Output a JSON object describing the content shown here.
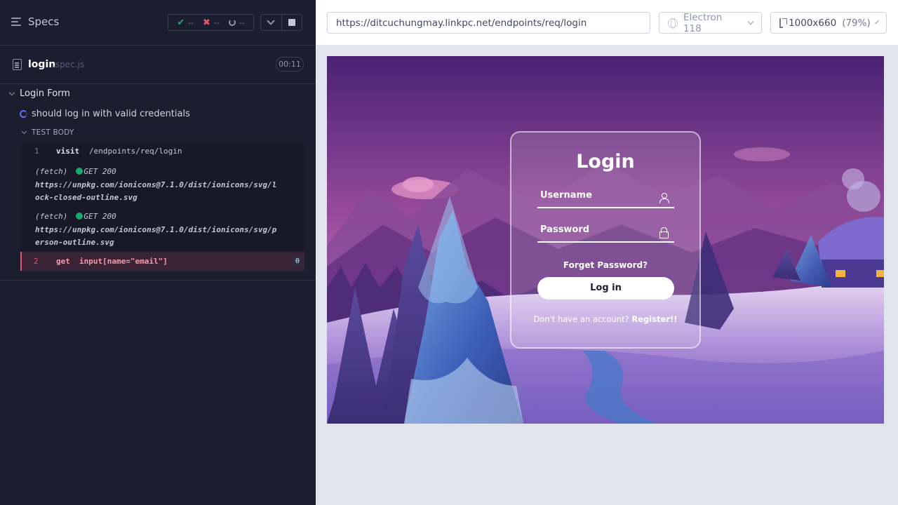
{
  "reporter": {
    "specs_label": "Specs",
    "stats": {
      "passed": "--",
      "failed": "--",
      "pending": "--"
    },
    "spec": {
      "name": "login",
      "ext": ".spec.js",
      "duration": "00:11"
    },
    "suite": {
      "title": "Login Form"
    },
    "test": {
      "title": "should log in with valid credentials"
    },
    "section": {
      "title": "TEST BODY"
    },
    "commands": [
      {
        "num": "1",
        "name": "visit",
        "message": "/endpoints/req/login"
      },
      {
        "num": "2",
        "name": "get",
        "message": "input[name=\"email\"]",
        "count": "0"
      }
    ],
    "fetches": [
      {
        "label": "(fetch)",
        "method": "GET 200",
        "url": "https://unpkg.com/ionicons@7.1.0/dist/ionicons/svg/lock-closed-outline.svg"
      },
      {
        "label": "(fetch)",
        "method": "GET 200",
        "url": "https://unpkg.com/ionicons@7.1.0/dist/ionicons/svg/person-outline.svg"
      }
    ]
  },
  "aut": {
    "url": "https://ditcuchungmay.linkpc.net/endpoints/req/login",
    "browser": "Electron 118",
    "viewport": "1000x660",
    "scale": "(79%)"
  },
  "login_page": {
    "title": "Login",
    "username_placeholder": "Username",
    "password_placeholder": "Password",
    "forgot": "Forget Password?",
    "login_button": "Log in",
    "register_prefix": "Don't have an account?",
    "register_link": "Register!!"
  },
  "colors": {
    "reporter_bg": "#1b1e2e",
    "pass": "#1fa971",
    "fail": "#e45770",
    "running": "#6470f3",
    "sky_top": "#5a2a7a",
    "snow": "#c7b8e8"
  },
  "icons": [
    "specs-icon",
    "pass-icon",
    "fail-icon",
    "pending-icon",
    "chevron-down-icon",
    "stop-icon",
    "document-icon",
    "spinner-icon",
    "globe-icon",
    "ruler-icon",
    "user-icon",
    "lock-icon"
  ]
}
